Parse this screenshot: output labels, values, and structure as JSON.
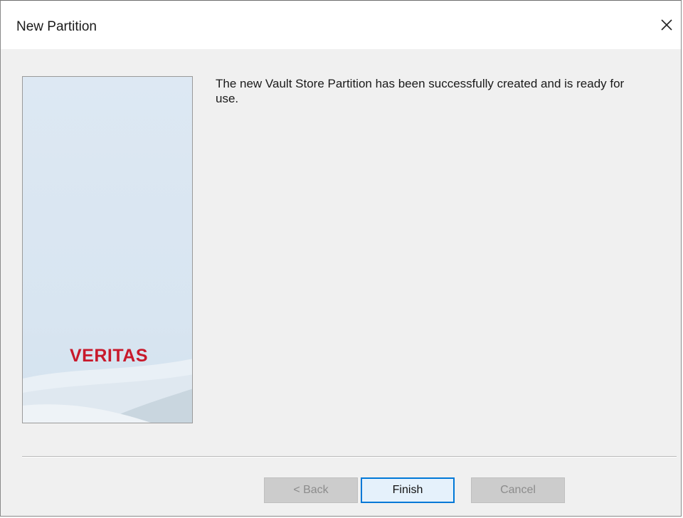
{
  "window": {
    "title": "New Partition"
  },
  "side_panel": {
    "logo_text": "VERITAS",
    "logo_color": "#c8192b"
  },
  "message": {
    "text": "The new Vault Store Partition has been successfully created and is ready for use."
  },
  "buttons": {
    "back_label": "< Back",
    "finish_label": "Finish",
    "cancel_label": "Cancel"
  },
  "colors": {
    "window_bg": "#f0f0f0",
    "titlebar_bg": "#ffffff",
    "default_button_border": "#0078d7",
    "disabled_button_bg": "#cccccc"
  },
  "icons": {
    "close": "close-icon"
  }
}
